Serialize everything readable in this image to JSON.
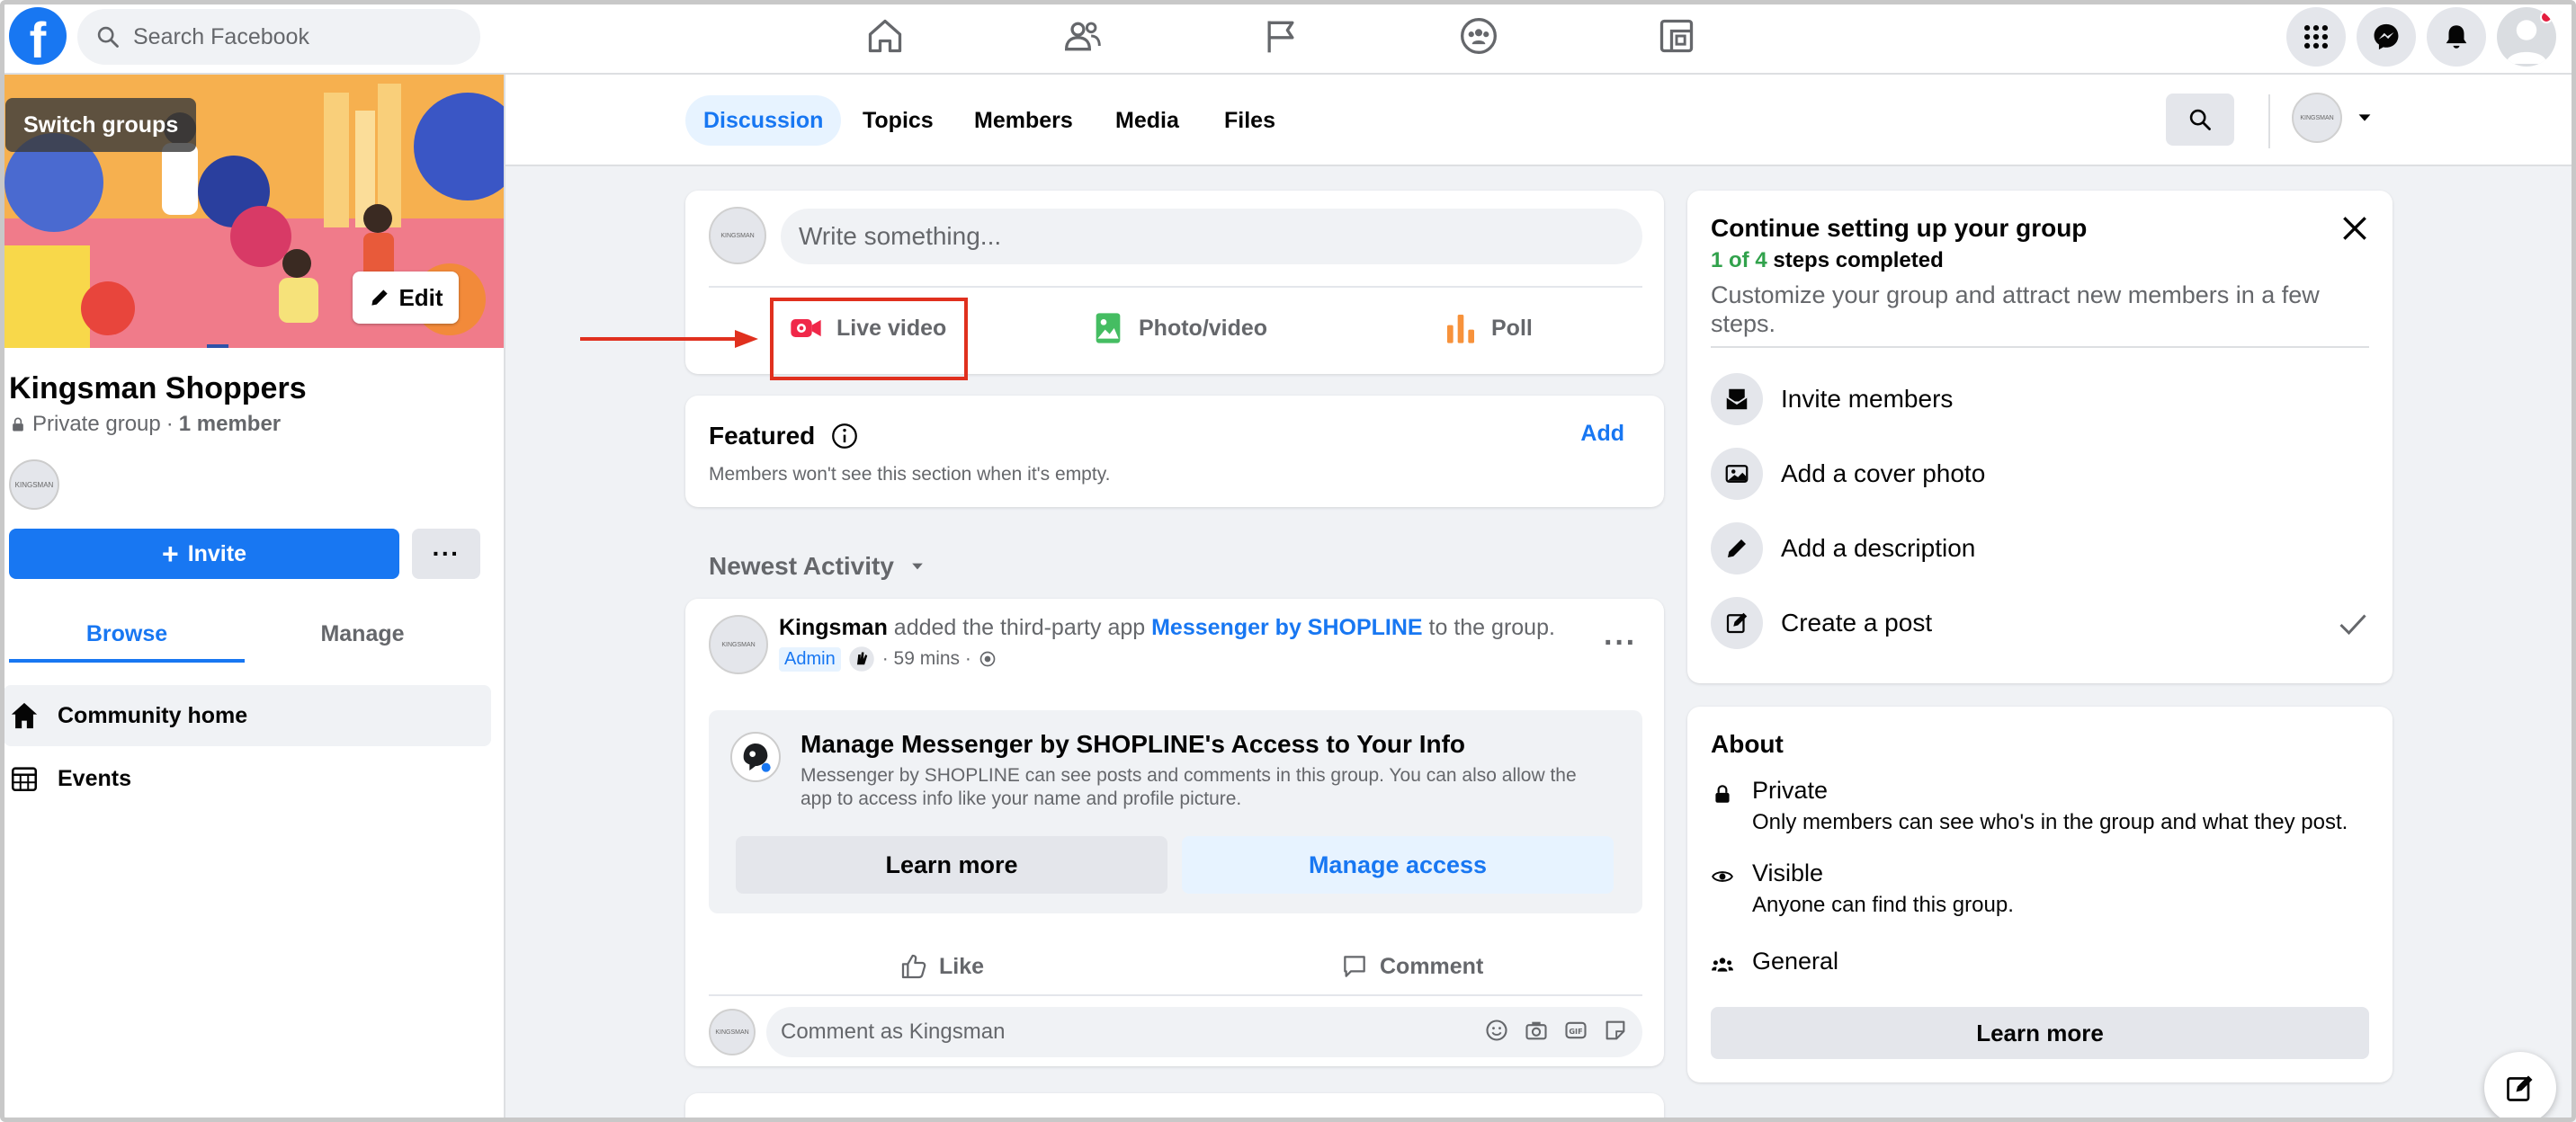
{
  "topbar": {
    "logo": "f",
    "search_placeholder": "Search Facebook",
    "nav_icons": [
      "home-icon",
      "friends-icon",
      "pages-flag-icon",
      "groups-icon",
      "gaming-icon"
    ],
    "right_icons": [
      "menu-grid-icon",
      "messenger-icon",
      "notifications-icon",
      "account-avatar"
    ]
  },
  "sidebar": {
    "switch_groups": "Switch groups",
    "edit": "Edit",
    "group_name": "Kingsman Shoppers",
    "privacy": "Private group",
    "separator": " · ",
    "members": "1 member",
    "avatar_text": "KINGSMAN",
    "invite": "Invite",
    "more": "···",
    "tabs": [
      "Browse",
      "Manage"
    ],
    "items": [
      {
        "label": "Community home",
        "icon": "home-icon"
      },
      {
        "label": "Events",
        "icon": "calendar-icon"
      }
    ]
  },
  "group_tabs": [
    "Discussion",
    "Topics",
    "Members",
    "Media",
    "Files"
  ],
  "composer": {
    "placeholder": "Write something...",
    "actions": [
      {
        "label": "Live video",
        "icon": "live-video-icon",
        "color": "#f02849"
      },
      {
        "label": "Photo/video",
        "icon": "photo-icon",
        "color": "#45bd62"
      },
      {
        "label": "Poll",
        "icon": "poll-icon",
        "color": "#f7923b"
      }
    ]
  },
  "featured": {
    "title": "Featured",
    "add": "Add",
    "subtitle": "Members won't see this section when it's empty."
  },
  "feed": {
    "sort_label": "Newest Activity"
  },
  "post": {
    "author": "Kingsman",
    "action_text": " added the third-party app ",
    "app_link": "Messenger by SHOPLINE",
    "suffix": " to the group.",
    "badge": "Admin",
    "time": "· 59 mins ·",
    "app_box": {
      "title": "Manage Messenger by SHOPLINE's Access to Your Info",
      "description": "Messenger by SHOPLINE can see posts and comments in this group. You can also allow the app to access info like your name and profile picture.",
      "learn_more": "Learn more",
      "manage_access": "Manage access"
    },
    "like": "Like",
    "comment": "Comment",
    "comment_placeholder": "Comment as Kingsman"
  },
  "setup": {
    "title": "Continue setting up your group",
    "progress_count": "1 of 4",
    "progress_text": " steps completed",
    "description": "Customize your group and attract new members in a few steps.",
    "items": [
      {
        "label": "Invite members",
        "icon": "invite-members-icon",
        "done": false
      },
      {
        "label": "Add a cover photo",
        "icon": "cover-photo-icon",
        "done": false
      },
      {
        "label": "Add a description",
        "icon": "pencil-icon",
        "done": false
      },
      {
        "label": "Create a post",
        "icon": "create-post-icon",
        "done": true
      }
    ]
  },
  "about": {
    "title": "About",
    "rows": [
      {
        "title": "Private",
        "subtitle": "Only members can see who's in the group and what they post.",
        "icon": "lock-icon"
      },
      {
        "title": "Visible",
        "subtitle": "Anyone can find this group.",
        "icon": "eye-icon"
      },
      {
        "title": "General",
        "subtitle": "",
        "icon": "people-icon"
      }
    ],
    "learn_more": "Learn more"
  },
  "colors": {
    "brand": "#1877f2",
    "annotation": "#e0301e",
    "success": "#31a24c"
  }
}
